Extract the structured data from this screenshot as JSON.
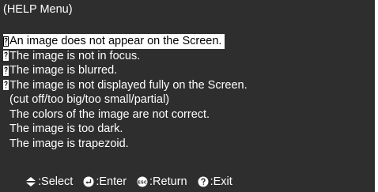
{
  "menu_title": "(HELP Menu)",
  "items": [
    {
      "label": "An image does not appear on the Screen.",
      "icon": "question-icon",
      "selected": true
    },
    {
      "label": "The image is not in focus.",
      "icon": "question-icon",
      "selected": false
    },
    {
      "label": "The image is blurred.",
      "icon": "question-icon",
      "selected": false
    },
    {
      "label": "The image is not displayed fully on the Screen.",
      "icon": "question-icon",
      "selected": false
    },
    {
      "label": "(cut off/too big/too small/partial)",
      "icon": "",
      "selected": false
    },
    {
      "label": "The colors of the image are not correct.",
      "icon": "",
      "selected": false
    },
    {
      "label": "The image is too dark.",
      "icon": "",
      "selected": false
    },
    {
      "label": "The image is trapezoid.",
      "icon": "",
      "selected": false
    }
  ],
  "footer": {
    "select_label": ":Select",
    "enter_label": ":Enter",
    "return_label": ":Return",
    "exit_label": ":Exit"
  },
  "colors": {
    "background": "#2e2e2e",
    "text": "#ffffff",
    "highlight": "#ffffff",
    "highlight_text": "#000000"
  }
}
